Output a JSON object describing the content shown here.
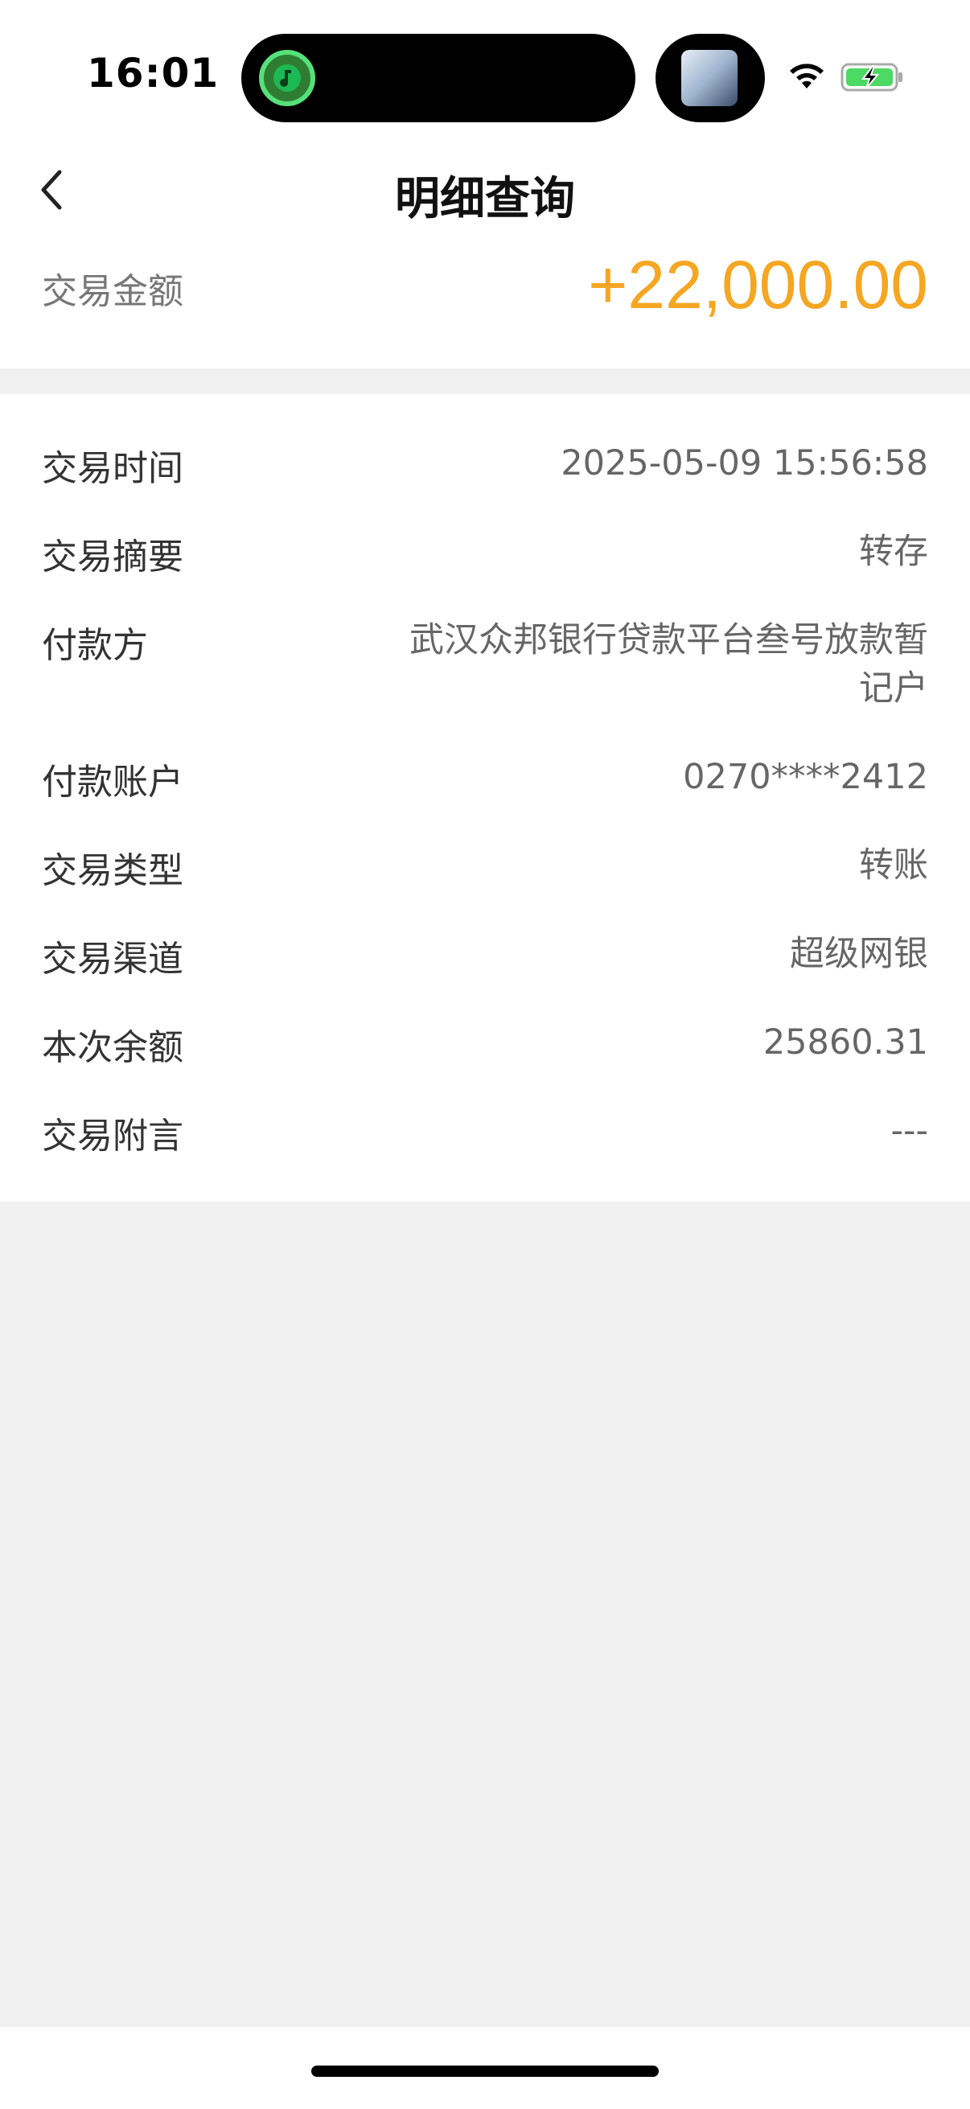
{
  "status_bar": {
    "time": "16:01"
  },
  "nav": {
    "title": "明细查询"
  },
  "amount": {
    "label": "交易金额",
    "value": "+22,000.00",
    "color": "#f5a623"
  },
  "details": [
    {
      "label": "交易时间",
      "value": "2025-05-09 15:56:58"
    },
    {
      "label": "交易摘要",
      "value": "转存"
    },
    {
      "label": "付款方",
      "value": "武汉众邦银行贷款平台叁号放款暂记户"
    },
    {
      "label": "付款账户",
      "value": "0270****2412"
    },
    {
      "label": "交易类型",
      "value": "转账"
    },
    {
      "label": "交易渠道",
      "value": "超级网银"
    },
    {
      "label": "本次余额",
      "value": "25860.31"
    },
    {
      "label": "交易附言",
      "value": "---"
    }
  ]
}
